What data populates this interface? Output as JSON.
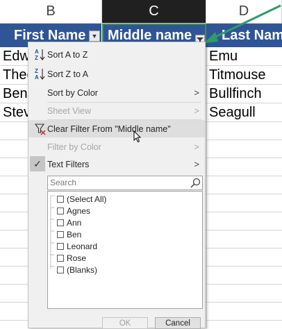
{
  "columns": {
    "b": {
      "letter": "B"
    },
    "c": {
      "letter": "C"
    },
    "d": {
      "letter": "D"
    }
  },
  "header_row": {
    "first_name": "First Name",
    "middle_name": "Middle name",
    "last_name": "Last Nam"
  },
  "cells": {
    "b": [
      "Edw",
      "Theo",
      "Ben",
      "Stev"
    ],
    "d": [
      "Emu",
      "Titmouse",
      "Bullfinch",
      "Seagull"
    ]
  },
  "menu": {
    "sort_az": "Sort A to Z",
    "sort_za": "Sort Z to A",
    "sort_by_color": "Sort by Color",
    "sheet_view": "Sheet View",
    "clear_filter": "Clear Filter From \"Middle name\"",
    "filter_by_color": "Filter by Color",
    "text_filters": "Text Filters",
    "chevron": ">",
    "check": "✓",
    "search_placeholder": "Search",
    "list": [
      {
        "label": "(Select All)",
        "checked": false
      },
      {
        "label": "Agnes",
        "checked": false
      },
      {
        "label": "Ann",
        "checked": false
      },
      {
        "label": "Ben",
        "checked": false
      },
      {
        "label": "Leonard",
        "checked": false
      },
      {
        "label": "Rose",
        "checked": false
      },
      {
        "label": "(Blanks)",
        "checked": false
      }
    ],
    "ok": "OK",
    "cancel": "Cancel"
  },
  "colors": {
    "header_fill": "#2f5597",
    "selection_border": "#3f8f4f",
    "arrow": "#2e9c6a"
  }
}
